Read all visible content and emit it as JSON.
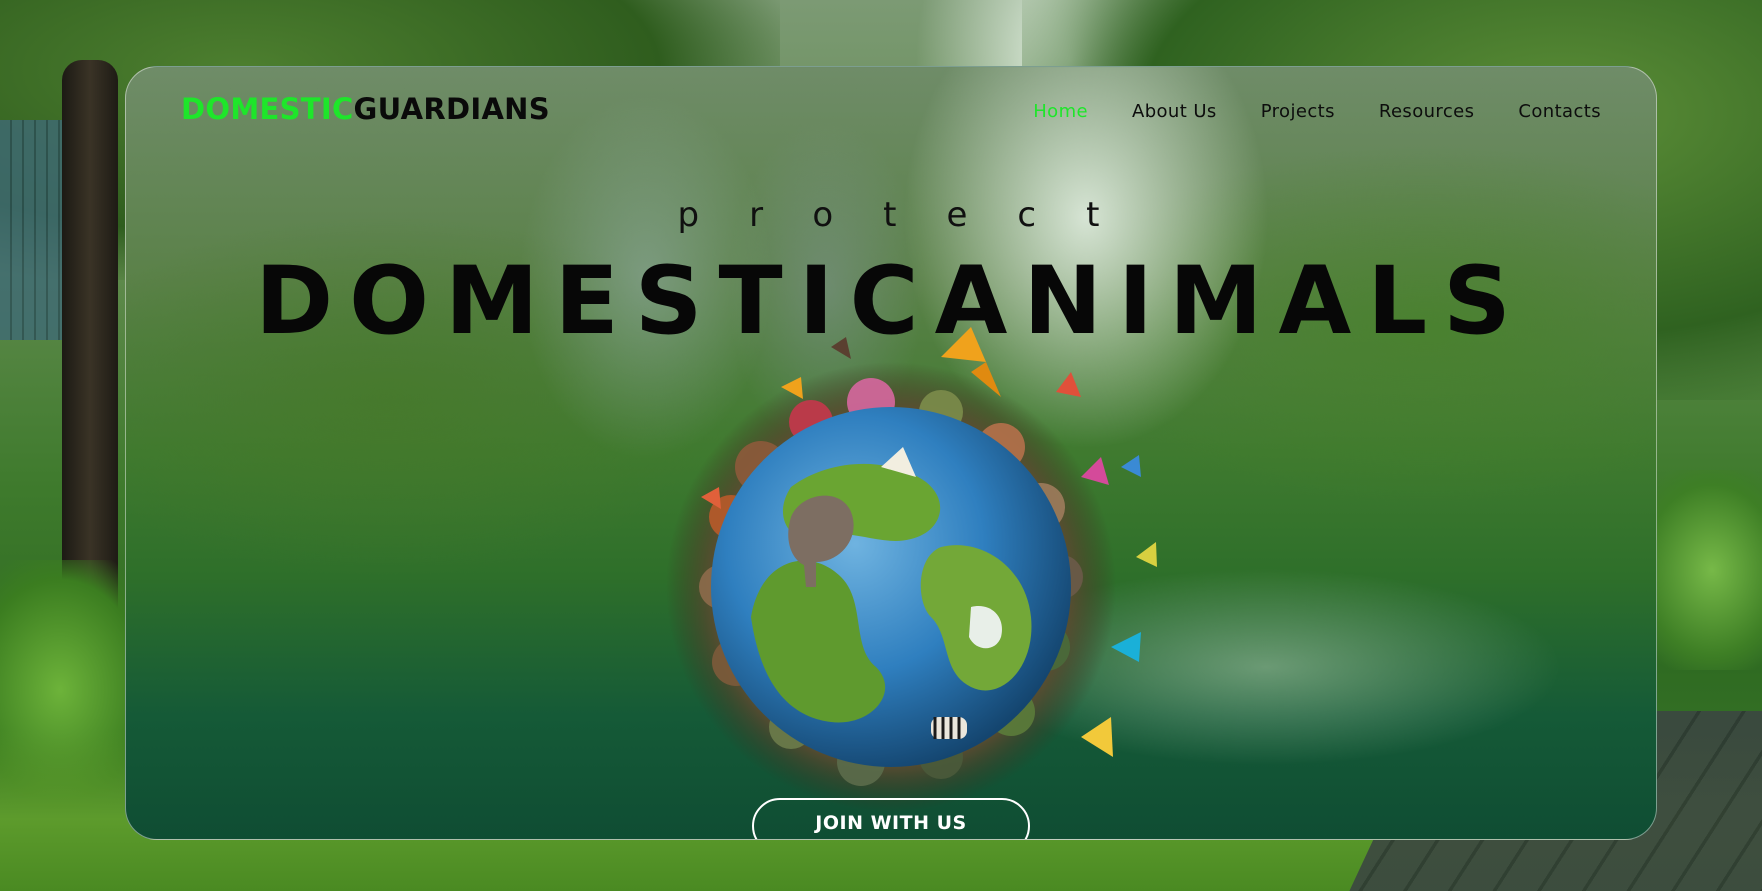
{
  "logo": {
    "part1": "DOMESTIC",
    "part2": "GUARDIANS"
  },
  "nav": {
    "items": [
      {
        "label": "Home",
        "active": true
      },
      {
        "label": "About Us",
        "active": false
      },
      {
        "label": "Projects",
        "active": false
      },
      {
        "label": "Resources",
        "active": false
      },
      {
        "label": "Contacts",
        "active": false
      }
    ]
  },
  "hero": {
    "kicker": "protect",
    "headline": "DOMESTICANIMALS",
    "cta_label": "JOIN WITH US",
    "illustration_icon": "earth-globe-with-animals-and-butterflies-icon"
  },
  "colors": {
    "accent": "#1ee62a",
    "text_dark": "#0a0a0a",
    "cta_text": "#ffffff"
  }
}
